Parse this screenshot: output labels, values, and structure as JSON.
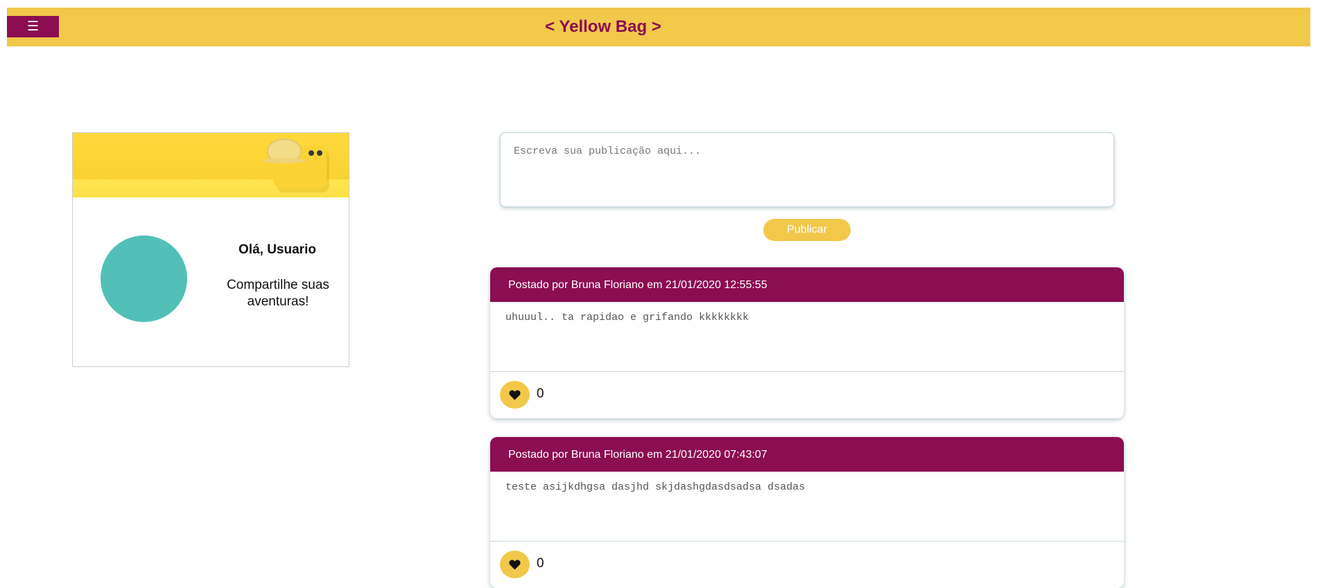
{
  "header": {
    "menu_icon": "hamburger-icon",
    "menu_glyph": "☰",
    "brand": "< Yellow Bag >"
  },
  "profile": {
    "cover_image": "yellow-bag-cover-image",
    "avatar_color": "#53c0b8",
    "greeting": "Olá, Usuario",
    "tagline": "Compartilhe suas aventuras!"
  },
  "composer": {
    "placeholder": "Escreva sua publicação aqui...",
    "value": "",
    "publish_label": "Publicar"
  },
  "posts": [
    {
      "header": "Postado por Bruna Floriano em 21/01/2020 12:55:55",
      "body": "uhuuul.. ta rapidao e grifando kkkkkkkk",
      "like_icon": "heart-icon",
      "likes": "0"
    },
    {
      "header": "Postado por Bruna Floriano em 21/01/2020 07:43:07",
      "body": "teste asijkdhgsa dasjhd skjdashgdasdsadsa dsadas",
      "like_icon": "heart-icon",
      "likes": "0"
    }
  ],
  "colors": {
    "brand_yellow": "#f2c84b",
    "brand_magenta": "#8b0d52",
    "avatar_teal": "#53c0b8"
  }
}
